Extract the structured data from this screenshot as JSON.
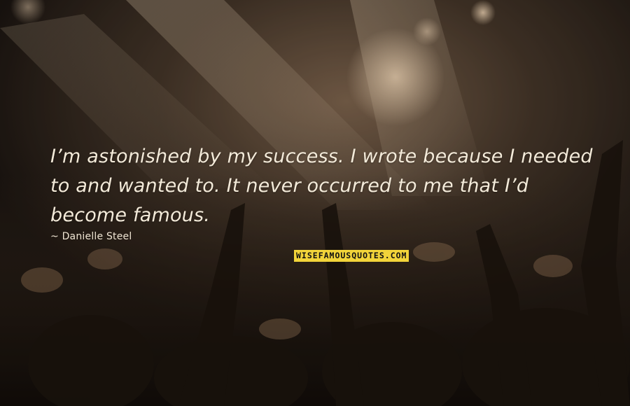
{
  "quote": {
    "lines": [
      "I’m astonished by my success. I wrote because I needed",
      "to and wanted to. It never occurred to me that I’d",
      "become famous."
    ]
  },
  "author": "~ Danielle Steel",
  "watermark": {
    "text": "WISEFAMOUSQUOTES.COM",
    "color": "#f2d43a"
  },
  "background": {
    "description_colors": [
      "#1a1410",
      "#5c4733",
      "#c7a07a"
    ]
  }
}
